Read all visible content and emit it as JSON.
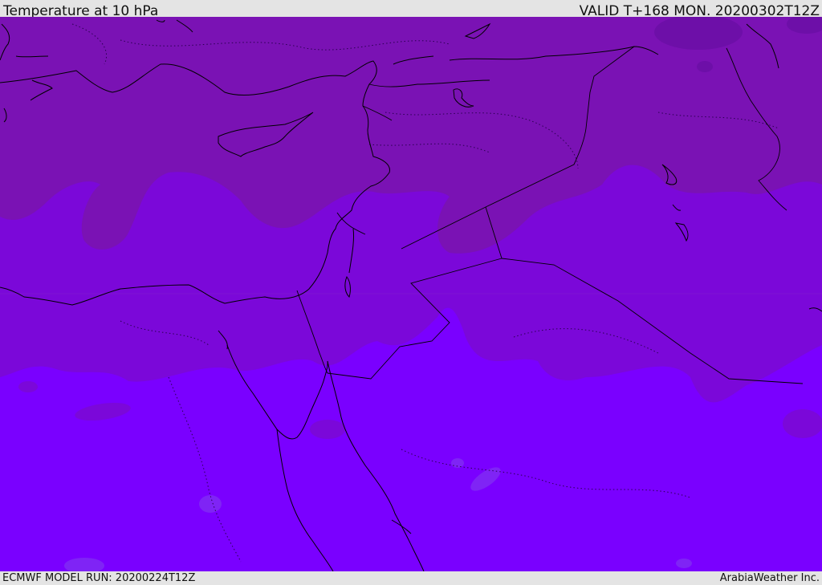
{
  "header": {
    "title": "Temperature at 10 hPa",
    "valid": "VALID T+168 MON. 20200302T12Z"
  },
  "footer": {
    "model_run": "ECMWF MODEL RUN: 20200224T12Z",
    "credit": "ArabiaWeather Inc."
  },
  "map": {
    "field": "temperature",
    "level": "10 hPa",
    "region": "Eastern Mediterranean / Middle East",
    "colors": {
      "band_cold": "#7a12b4",
      "band_mid": "#7b08d9",
      "band_warm": "#7a00ff",
      "patch_warmer": "#7f24f5",
      "patch_darker": "#6d0fa8",
      "coastline": "#000000"
    }
  }
}
